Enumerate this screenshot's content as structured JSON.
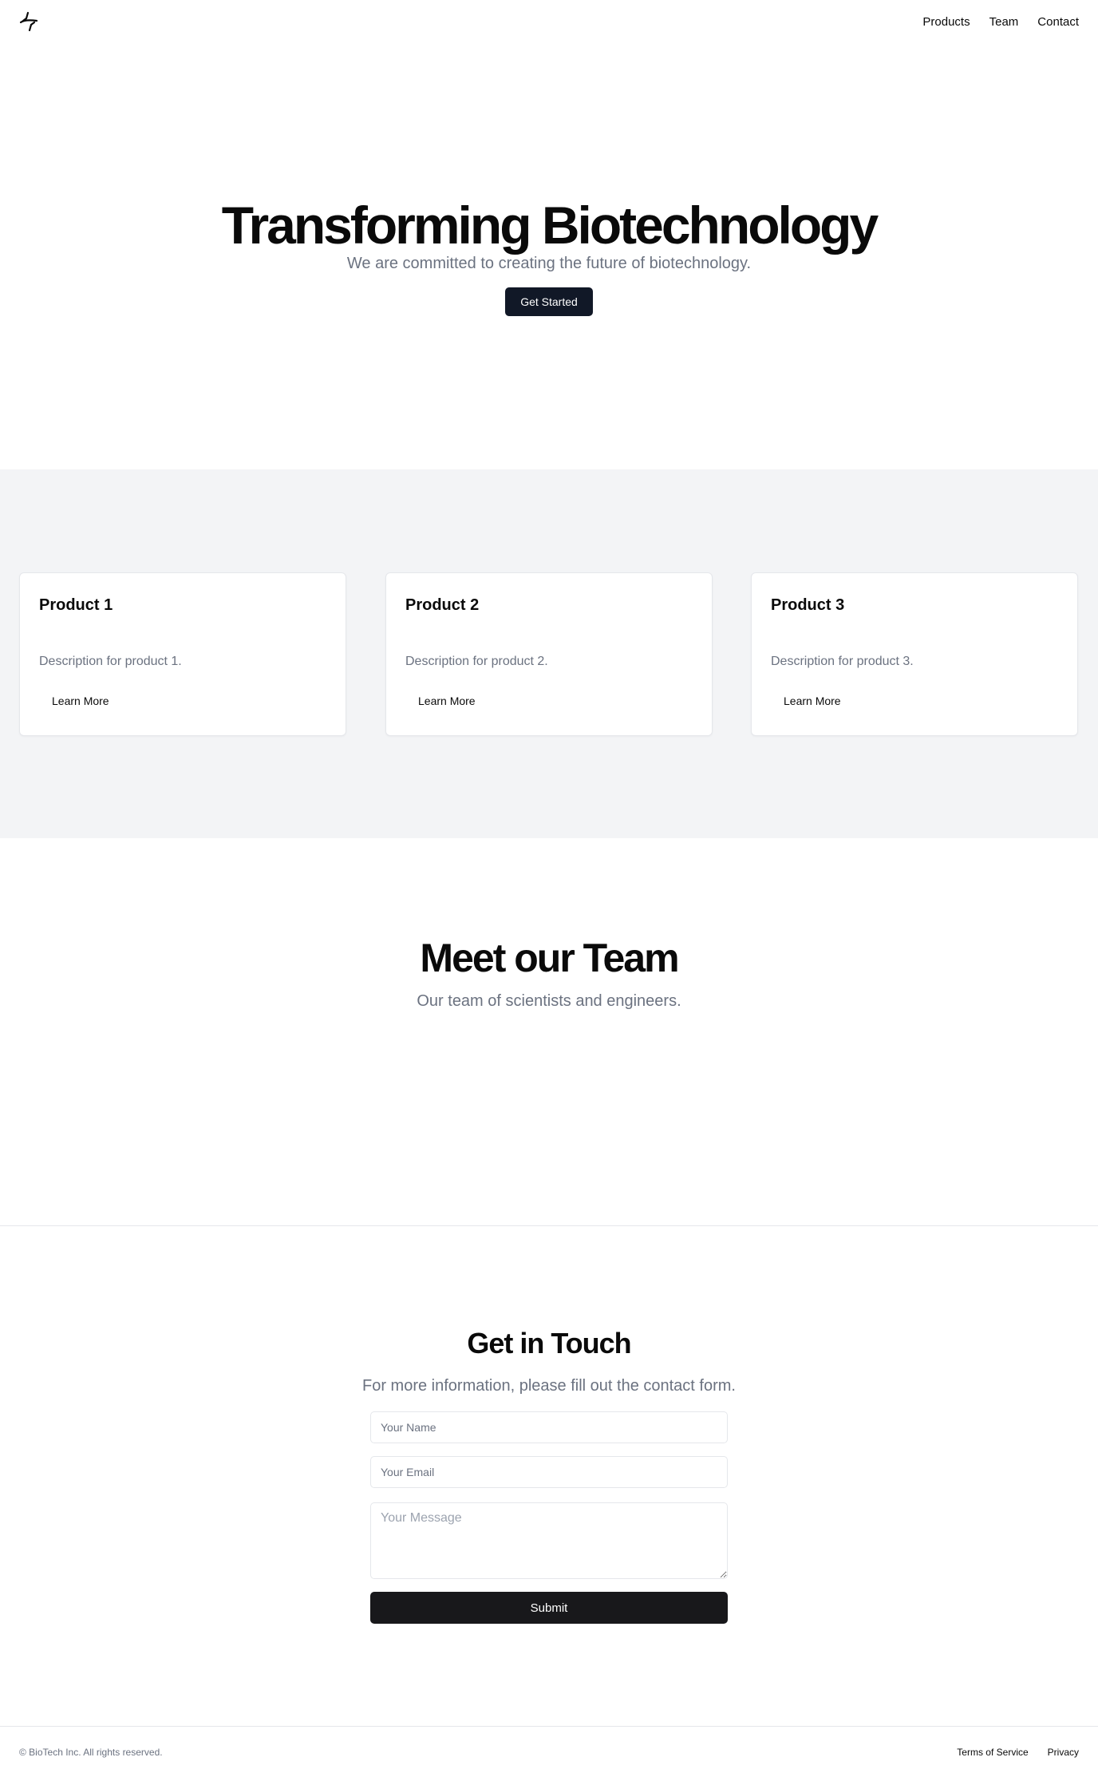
{
  "header": {
    "logo_icon": "dna-helix-icon",
    "nav": [
      {
        "label": "Products"
      },
      {
        "label": "Team"
      },
      {
        "label": "Contact"
      }
    ]
  },
  "hero": {
    "title": "Transforming Biotechnology",
    "subtitle": "We are committed to creating the future of biotechnology.",
    "cta_label": "Get Started"
  },
  "products": {
    "cards": [
      {
        "title": "Product 1",
        "description": "Description for product 1.",
        "link_label": "Learn More"
      },
      {
        "title": "Product 2",
        "description": "Description for product 2.",
        "link_label": "Learn More"
      },
      {
        "title": "Product 3",
        "description": "Description for product 3.",
        "link_label": "Learn More"
      }
    ]
  },
  "team": {
    "title": "Meet our Team",
    "subtitle": "Our team of scientists and engineers."
  },
  "contact": {
    "title": "Get in Touch",
    "subtitle": "For more information, please fill out the contact form.",
    "name_placeholder": "Your Name",
    "email_placeholder": "Your Email",
    "message_placeholder": "Your Message",
    "submit_label": "Submit"
  },
  "footer": {
    "copyright": "© BioTech Inc. All rights reserved.",
    "links": [
      {
        "label": "Terms of Service"
      },
      {
        "label": "Privacy"
      }
    ]
  },
  "colors": {
    "primary_dark": "#111827",
    "submit_dark": "#18181b",
    "muted_text": "#6b7280",
    "section_bg": "#f3f4f6",
    "border": "#e5e7eb"
  }
}
